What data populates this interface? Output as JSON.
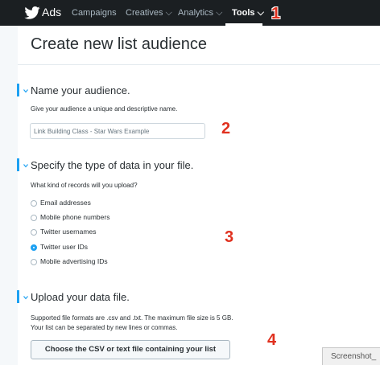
{
  "nav": {
    "brand": "Ads",
    "items": [
      {
        "label": "Campaigns"
      },
      {
        "label": "Creatives ⌵"
      },
      {
        "label": "Analytics ⌵"
      },
      {
        "label": "Tools ⌵"
      }
    ],
    "active": "Tools"
  },
  "annotations": [
    "1",
    "2",
    "3",
    "4"
  ],
  "page": {
    "title": "Create new list audience"
  },
  "sections": {
    "name": {
      "title": "Name your audience.",
      "hint": "Give your audience a unique and descriptive name.",
      "input_value": "Link Building Class - Star Wars Example"
    },
    "type": {
      "title": "Specify the type of data in your file.",
      "hint": "What kind of records will you upload?",
      "options": [
        {
          "label": "Email addresses",
          "checked": false
        },
        {
          "label": "Mobile phone numbers",
          "checked": false
        },
        {
          "label": "Twitter usernames",
          "checked": false
        },
        {
          "label": "Twitter user IDs",
          "checked": true
        },
        {
          "label": "Mobile advertising IDs",
          "checked": false
        }
      ]
    },
    "upload": {
      "title": "Upload your data file.",
      "hint_line1": "Supported file formats are .csv and .txt. The maximum file size is 5 GB.",
      "hint_line2": "Your list can be separated by new lines or commas.",
      "button_label": "Choose the CSV or text file containing your list"
    }
  },
  "screenshot_tab": "Screenshot_",
  "colors": {
    "accent": "#1da1f2",
    "annotation": "#e0301e",
    "nav_bg": "#1b1f22"
  }
}
